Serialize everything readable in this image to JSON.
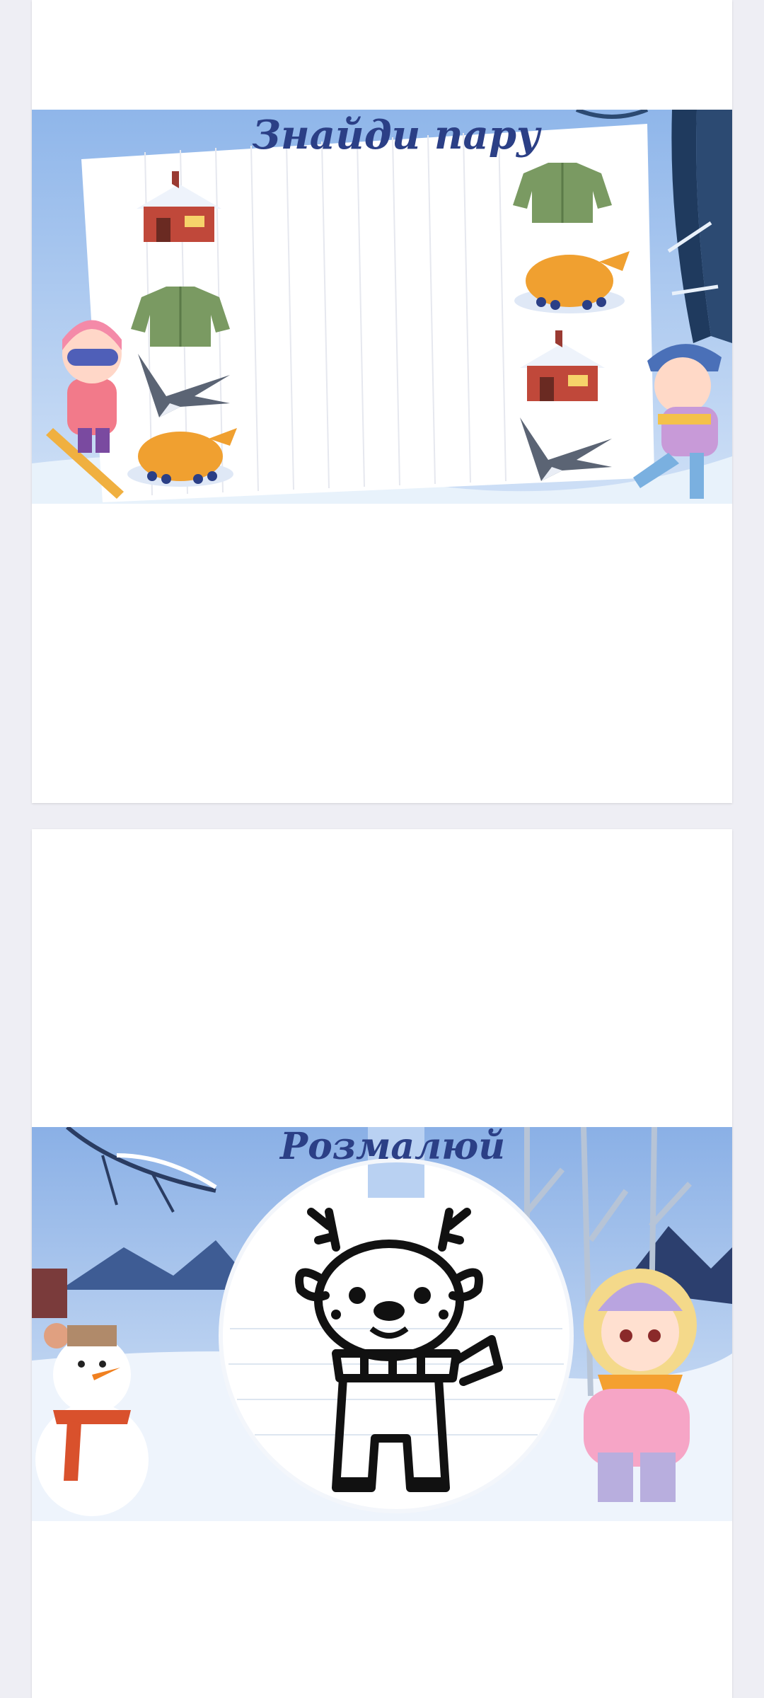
{
  "document": {
    "pages": [
      {
        "slide": {
          "title": "Знайди пару",
          "left_items": [
            "house-icon",
            "jacket-icon",
            "swallow-icon",
            "roast-chicken-icon"
          ],
          "right_items": [
            "jacket-icon",
            "roast-chicken-icon",
            "house-icon",
            "swallow-icon"
          ],
          "characters": [
            "girl-skier",
            "boy-skater"
          ]
        }
      },
      {
        "slide": {
          "title": "Розмалюй",
          "coloring_subject": "reindeer-with-scarf-outline",
          "characters": [
            "snowman",
            "girl-in-winter-coat"
          ]
        }
      }
    ]
  },
  "colors": {
    "page_background": "#eeeef4",
    "sheet": "#ffffff",
    "title": "#2b3f86",
    "sky": "#9ec0ec",
    "jacket": "#7a9a62",
    "chicken": "#f0a030",
    "house": "#c0483a"
  }
}
